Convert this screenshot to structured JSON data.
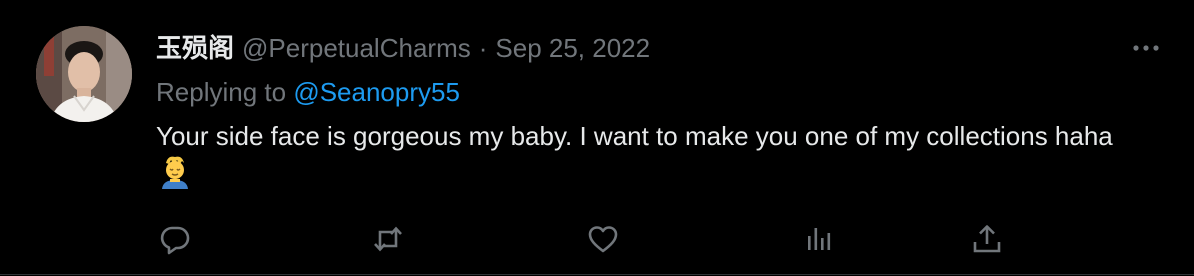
{
  "tweet": {
    "display_name": "玉殒阁",
    "handle": "@PerpetualCharms",
    "separator": "·",
    "date": "Sep 25, 2022",
    "replying_label": "Replying to ",
    "replying_handle": "@Seanopry55",
    "text": "Your side face is gorgeous my baby. I want to make you one of my collections haha",
    "emoji": "person-getting-massage-emoji"
  },
  "actions": {
    "icons": [
      "reply-icon",
      "retweet-icon",
      "like-icon",
      "analytics-icon",
      "share-icon"
    ]
  },
  "colors": {
    "background": "#000000",
    "primary_text": "#e7e9ea",
    "secondary_text": "#71767b",
    "accent": "#1d9bf0",
    "border": "#2f3336"
  }
}
